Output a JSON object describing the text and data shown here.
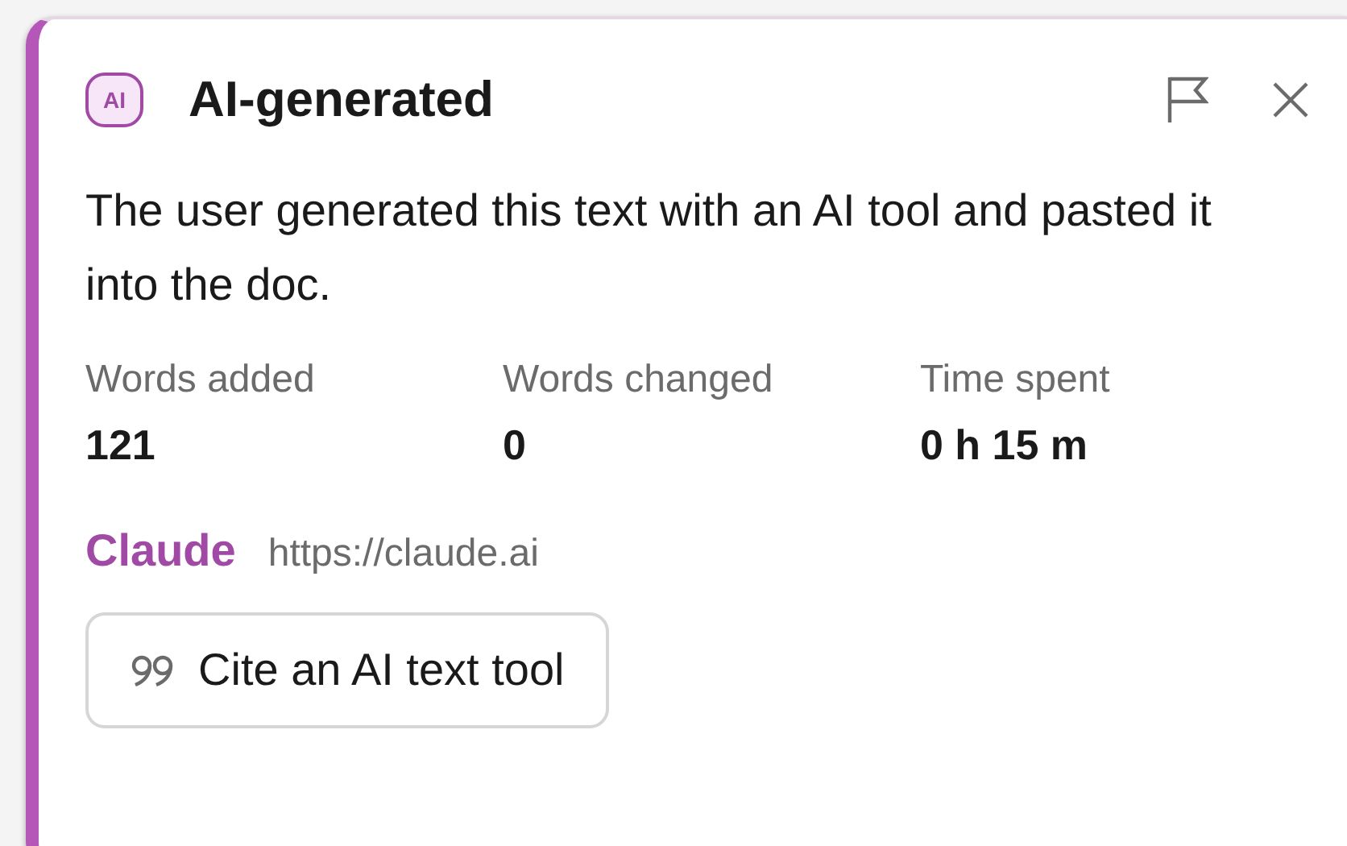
{
  "header": {
    "badge": "AI",
    "title": "AI-generated"
  },
  "description": "The user generated this text with an AI tool and pasted it into the doc.",
  "stats": [
    {
      "label": "Words added",
      "value": "121"
    },
    {
      "label": "Words changed",
      "value": "0"
    },
    {
      "label": "Time spent",
      "value": "0 h 15 m"
    }
  ],
  "source": {
    "name": "Claude",
    "url": "https://claude.ai"
  },
  "button": {
    "label": "Cite an AI text tool"
  }
}
